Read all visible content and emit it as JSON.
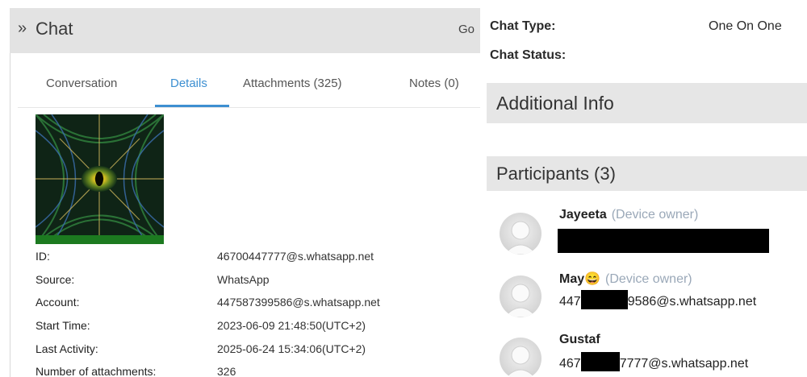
{
  "header": {
    "title": "Chat",
    "chevron": "»",
    "truncated_link": "Go"
  },
  "tabs": [
    {
      "label": "Conversation"
    },
    {
      "label": "Details"
    },
    {
      "label": "Attachments (325)"
    },
    {
      "label": "Notes (0)"
    }
  ],
  "active_tab": "Details",
  "details": [
    {
      "key": "ID:",
      "value": "46700447777@s.whatsapp.net"
    },
    {
      "key": "Source:",
      "value": "WhatsApp"
    },
    {
      "key": "Account:",
      "value": "447587399586@s.whatsapp.net"
    },
    {
      "key": "Start Time:",
      "value": "2023-06-09 21:48:50(UTC+2)"
    },
    {
      "key": "Last Activity:",
      "value": "2025-06-24 15:34:06(UTC+2)"
    },
    {
      "key": "Number of attachments:",
      "value": "326"
    }
  ],
  "info": {
    "chat_type_label": "Chat Type:",
    "chat_type_value": "One On One",
    "chat_status_label": "Chat Status:"
  },
  "sections": {
    "additional_info": "Additional Info",
    "participants": "Participants (3)"
  },
  "participants": [
    {
      "name": "Jayeeta",
      "owner_tag": "(Device owner)",
      "id": ""
    },
    {
      "name": "May😄",
      "owner_tag": "(Device owner)",
      "id_prefix": "447",
      "id_suffix": "9586@s.whatsapp.net"
    },
    {
      "name": "Gustaf",
      "owner_tag": "",
      "id_prefix": "467",
      "id_suffix": "7777@s.whatsapp.net"
    }
  ],
  "icons": {
    "avatar": "user-silhouette-icon",
    "chevron": "double-chevron-right-icon"
  },
  "colors": {
    "accent": "#3d8fd1",
    "header_bg": "#e3e3e3",
    "section_bg": "#e6e6e6",
    "owner_tag": "#9aa8b8"
  }
}
